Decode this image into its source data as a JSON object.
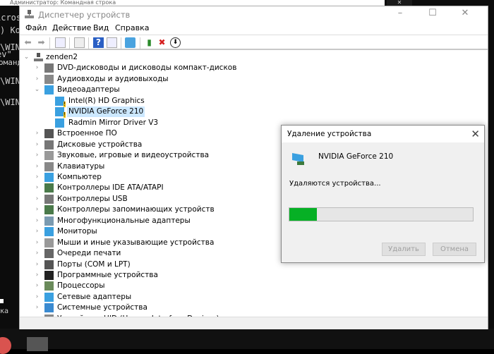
{
  "background_console": {
    "title": "Администратор: Командная строка",
    "lines": [
      "icros",
      ") Ko",
      "\\WIN",
      "ev\"",
      "оманд",
      "\\WIN",
      "\\WIN",
      "ка"
    ]
  },
  "window": {
    "title": "Диспетчер устройств",
    "controls": {
      "minimize": "–",
      "maximize": "☐",
      "close": "✕"
    }
  },
  "menu": [
    "Файл",
    "Действие",
    "Вид",
    "Справка"
  ],
  "toolbar": [
    "back-icon",
    "forward-icon",
    "show-hide-console-tree-icon",
    "properties-icon",
    "help-icon",
    "action-pane-icon",
    "monitor-icon",
    "update-driver-icon",
    "uninstall-icon",
    "enable-disable-icon"
  ],
  "tree": {
    "root": "zenden2",
    "items": [
      {
        "label": "DVD-дисководы и дисководы компакт-дисков",
        "level": 1,
        "expanded": false
      },
      {
        "label": "Аудиовходы и аудиовыходы",
        "level": 1,
        "expanded": false
      },
      {
        "label": "Видеоадаптеры",
        "level": 1,
        "expanded": true
      },
      {
        "label": "Intel(R) HD Graphics",
        "level": 2,
        "warning": true
      },
      {
        "label": "NVIDIA GeForce 210",
        "level": 2,
        "warning": true,
        "selected": true
      },
      {
        "label": "Radmin Mirror Driver V3",
        "level": 2
      },
      {
        "label": "Встроенное ПО",
        "level": 1,
        "expanded": false
      },
      {
        "label": "Дисковые устройства",
        "level": 1,
        "expanded": false
      },
      {
        "label": "Звуковые, игровые и видеоустройства",
        "level": 1,
        "expanded": false
      },
      {
        "label": "Клавиатуры",
        "level": 1,
        "expanded": false
      },
      {
        "label": "Компьютер",
        "level": 1,
        "expanded": false
      },
      {
        "label": "Контроллеры IDE ATA/ATAPI",
        "level": 1,
        "expanded": false
      },
      {
        "label": "Контроллеры USB",
        "level": 1,
        "expanded": false
      },
      {
        "label": "Контроллеры запоминающих устройств",
        "level": 1,
        "expanded": false
      },
      {
        "label": "Многофункциональные адаптеры",
        "level": 1,
        "expanded": false
      },
      {
        "label": "Мониторы",
        "level": 1,
        "expanded": false
      },
      {
        "label": "Мыши и иные указывающие устройства",
        "level": 1,
        "expanded": false
      },
      {
        "label": "Очереди печати",
        "level": 1,
        "expanded": false
      },
      {
        "label": "Порты (COM и LPT)",
        "level": 1,
        "expanded": false
      },
      {
        "label": "Программные устройства",
        "level": 1,
        "expanded": false
      },
      {
        "label": "Процессоры",
        "level": 1,
        "expanded": false
      },
      {
        "label": "Сетевые адаптеры",
        "level": 1,
        "expanded": false
      },
      {
        "label": "Системные устройства",
        "level": 1,
        "expanded": false
      },
      {
        "label": "Устройства HID (Human Interface Devices)",
        "level": 1,
        "expanded": false
      }
    ]
  },
  "dialog": {
    "title": "Удаление устройства",
    "device": "NVIDIA GeForce 210",
    "message": "Удаляются устройства...",
    "progress_percent": 15,
    "progress_color": "#06b025",
    "buttons": {
      "uninstall": "Удалить",
      "cancel": "Отмена"
    },
    "close": "✕"
  }
}
